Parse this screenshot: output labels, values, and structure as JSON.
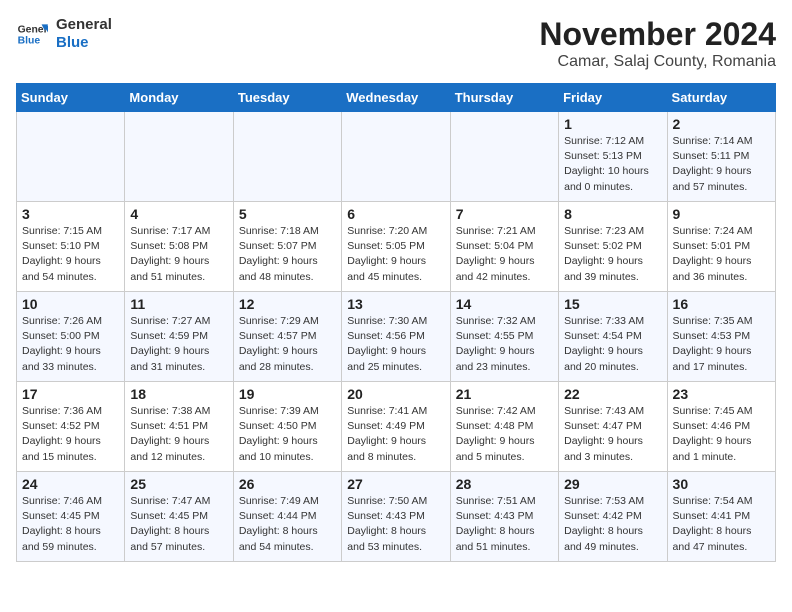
{
  "logo": {
    "line1": "General",
    "line2": "Blue"
  },
  "title": "November 2024",
  "subtitle": "Camar, Salaj County, Romania",
  "days_of_week": [
    "Sunday",
    "Monday",
    "Tuesday",
    "Wednesday",
    "Thursday",
    "Friday",
    "Saturday"
  ],
  "weeks": [
    [
      {
        "day": "",
        "info": ""
      },
      {
        "day": "",
        "info": ""
      },
      {
        "day": "",
        "info": ""
      },
      {
        "day": "",
        "info": ""
      },
      {
        "day": "",
        "info": ""
      },
      {
        "day": "1",
        "info": "Sunrise: 7:12 AM\nSunset: 5:13 PM\nDaylight: 10 hours\nand 0 minutes."
      },
      {
        "day": "2",
        "info": "Sunrise: 7:14 AM\nSunset: 5:11 PM\nDaylight: 9 hours\nand 57 minutes."
      }
    ],
    [
      {
        "day": "3",
        "info": "Sunrise: 7:15 AM\nSunset: 5:10 PM\nDaylight: 9 hours\nand 54 minutes."
      },
      {
        "day": "4",
        "info": "Sunrise: 7:17 AM\nSunset: 5:08 PM\nDaylight: 9 hours\nand 51 minutes."
      },
      {
        "day": "5",
        "info": "Sunrise: 7:18 AM\nSunset: 5:07 PM\nDaylight: 9 hours\nand 48 minutes."
      },
      {
        "day": "6",
        "info": "Sunrise: 7:20 AM\nSunset: 5:05 PM\nDaylight: 9 hours\nand 45 minutes."
      },
      {
        "day": "7",
        "info": "Sunrise: 7:21 AM\nSunset: 5:04 PM\nDaylight: 9 hours\nand 42 minutes."
      },
      {
        "day": "8",
        "info": "Sunrise: 7:23 AM\nSunset: 5:02 PM\nDaylight: 9 hours\nand 39 minutes."
      },
      {
        "day": "9",
        "info": "Sunrise: 7:24 AM\nSunset: 5:01 PM\nDaylight: 9 hours\nand 36 minutes."
      }
    ],
    [
      {
        "day": "10",
        "info": "Sunrise: 7:26 AM\nSunset: 5:00 PM\nDaylight: 9 hours\nand 33 minutes."
      },
      {
        "day": "11",
        "info": "Sunrise: 7:27 AM\nSunset: 4:59 PM\nDaylight: 9 hours\nand 31 minutes."
      },
      {
        "day": "12",
        "info": "Sunrise: 7:29 AM\nSunset: 4:57 PM\nDaylight: 9 hours\nand 28 minutes."
      },
      {
        "day": "13",
        "info": "Sunrise: 7:30 AM\nSunset: 4:56 PM\nDaylight: 9 hours\nand 25 minutes."
      },
      {
        "day": "14",
        "info": "Sunrise: 7:32 AM\nSunset: 4:55 PM\nDaylight: 9 hours\nand 23 minutes."
      },
      {
        "day": "15",
        "info": "Sunrise: 7:33 AM\nSunset: 4:54 PM\nDaylight: 9 hours\nand 20 minutes."
      },
      {
        "day": "16",
        "info": "Sunrise: 7:35 AM\nSunset: 4:53 PM\nDaylight: 9 hours\nand 17 minutes."
      }
    ],
    [
      {
        "day": "17",
        "info": "Sunrise: 7:36 AM\nSunset: 4:52 PM\nDaylight: 9 hours\nand 15 minutes."
      },
      {
        "day": "18",
        "info": "Sunrise: 7:38 AM\nSunset: 4:51 PM\nDaylight: 9 hours\nand 12 minutes."
      },
      {
        "day": "19",
        "info": "Sunrise: 7:39 AM\nSunset: 4:50 PM\nDaylight: 9 hours\nand 10 minutes."
      },
      {
        "day": "20",
        "info": "Sunrise: 7:41 AM\nSunset: 4:49 PM\nDaylight: 9 hours\nand 8 minutes."
      },
      {
        "day": "21",
        "info": "Sunrise: 7:42 AM\nSunset: 4:48 PM\nDaylight: 9 hours\nand 5 minutes."
      },
      {
        "day": "22",
        "info": "Sunrise: 7:43 AM\nSunset: 4:47 PM\nDaylight: 9 hours\nand 3 minutes."
      },
      {
        "day": "23",
        "info": "Sunrise: 7:45 AM\nSunset: 4:46 PM\nDaylight: 9 hours\nand 1 minute."
      }
    ],
    [
      {
        "day": "24",
        "info": "Sunrise: 7:46 AM\nSunset: 4:45 PM\nDaylight: 8 hours\nand 59 minutes."
      },
      {
        "day": "25",
        "info": "Sunrise: 7:47 AM\nSunset: 4:45 PM\nDaylight: 8 hours\nand 57 minutes."
      },
      {
        "day": "26",
        "info": "Sunrise: 7:49 AM\nSunset: 4:44 PM\nDaylight: 8 hours\nand 54 minutes."
      },
      {
        "day": "27",
        "info": "Sunrise: 7:50 AM\nSunset: 4:43 PM\nDaylight: 8 hours\nand 53 minutes."
      },
      {
        "day": "28",
        "info": "Sunrise: 7:51 AM\nSunset: 4:43 PM\nDaylight: 8 hours\nand 51 minutes."
      },
      {
        "day": "29",
        "info": "Sunrise: 7:53 AM\nSunset: 4:42 PM\nDaylight: 8 hours\nand 49 minutes."
      },
      {
        "day": "30",
        "info": "Sunrise: 7:54 AM\nSunset: 4:41 PM\nDaylight: 8 hours\nand 47 minutes."
      }
    ]
  ]
}
